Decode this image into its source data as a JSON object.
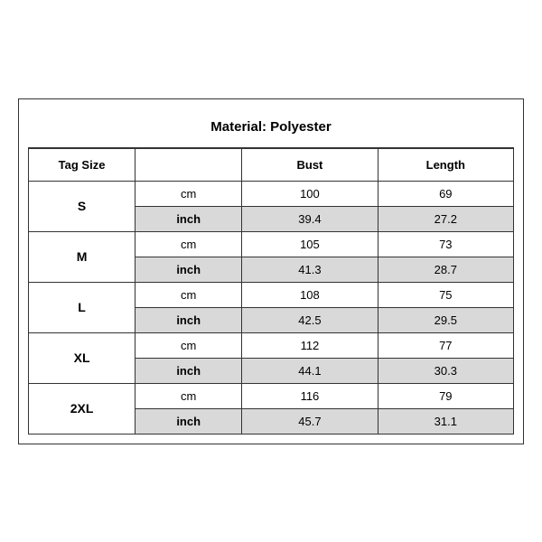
{
  "title": "Material: Polyester",
  "headers": {
    "tag_size": "Tag Size",
    "bust": "Bust",
    "length": "Length"
  },
  "rows": [
    {
      "size": "S",
      "cm": {
        "bust": "100",
        "length": "69"
      },
      "inch": {
        "bust": "39.4",
        "length": "27.2"
      }
    },
    {
      "size": "M",
      "cm": {
        "bust": "105",
        "length": "73"
      },
      "inch": {
        "bust": "41.3",
        "length": "28.7"
      }
    },
    {
      "size": "L",
      "cm": {
        "bust": "108",
        "length": "75"
      },
      "inch": {
        "bust": "42.5",
        "length": "29.5"
      }
    },
    {
      "size": "XL",
      "cm": {
        "bust": "112",
        "length": "77"
      },
      "inch": {
        "bust": "44.1",
        "length": "30.3"
      }
    },
    {
      "size": "2XL",
      "cm": {
        "bust": "116",
        "length": "79"
      },
      "inch": {
        "bust": "45.7",
        "length": "31.1"
      }
    }
  ],
  "units": {
    "cm": "cm",
    "inch": "inch"
  }
}
